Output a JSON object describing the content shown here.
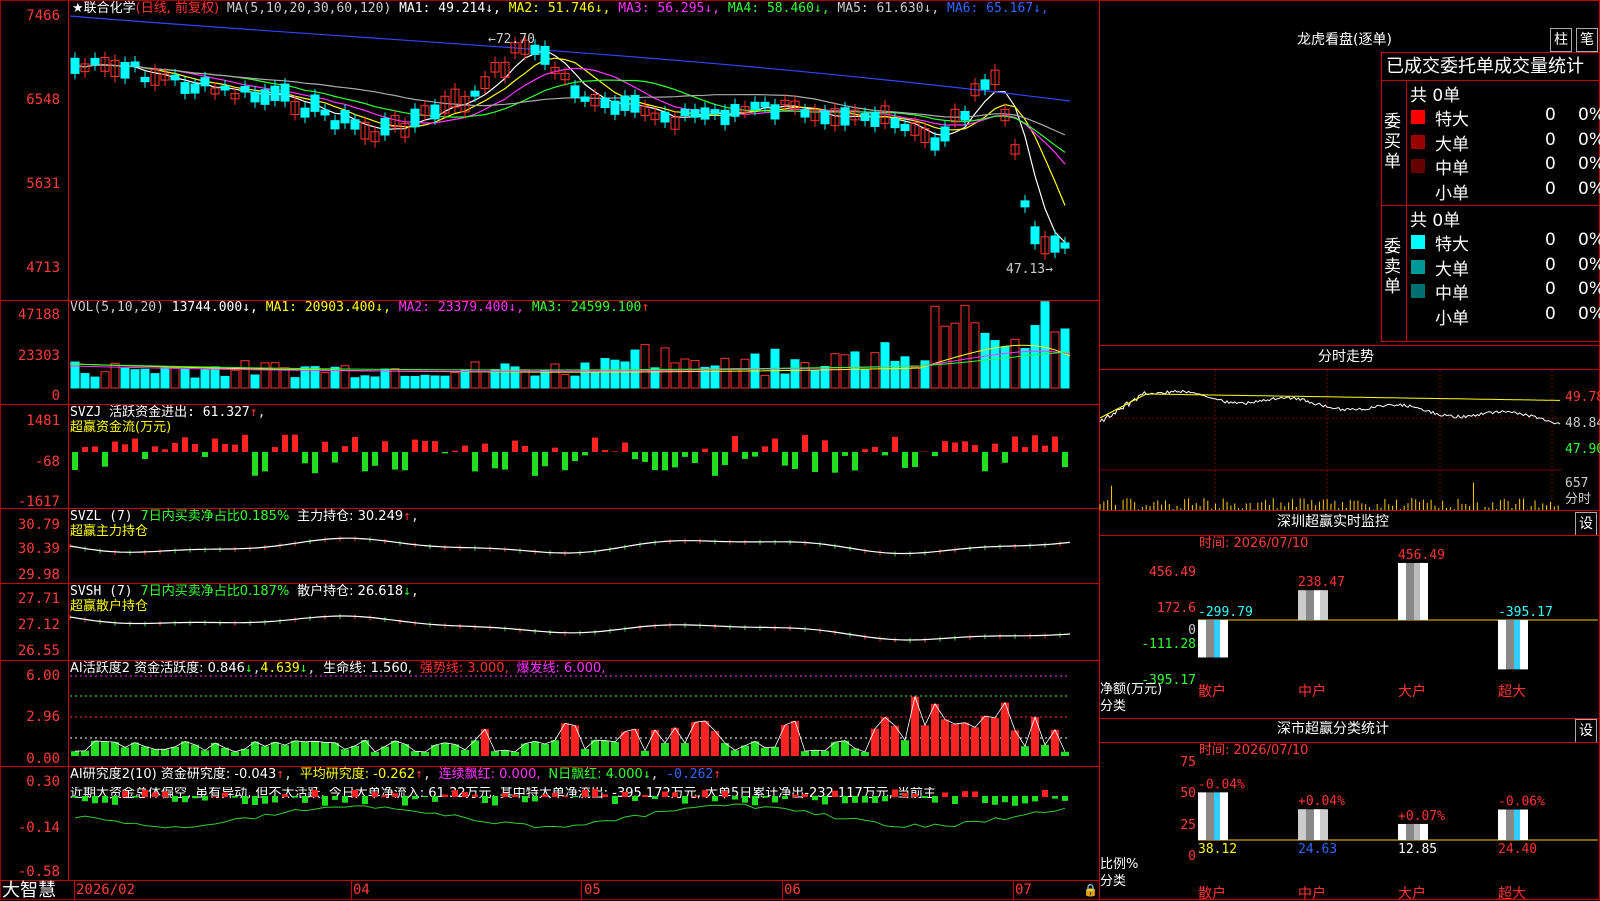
{
  "stock": {
    "title": "★联合化学",
    "mode": "(日线, 前复权)",
    "ma_label": "MA(5,10,20,30,60,120)",
    "ma": [
      {
        "k": "MA1",
        "v": "49.214",
        "arrow": "↓",
        "color": "#ffffff"
      },
      {
        "k": "MA2",
        "v": "51.746",
        "arrow": "↓",
        "color": "#ffff00"
      },
      {
        "k": "MA3",
        "v": "56.295",
        "arrow": "↓",
        "color": "#ff33ff"
      },
      {
        "k": "MA4",
        "v": "58.460",
        "arrow": "↓",
        "color": "#33ff33"
      },
      {
        "k": "MA5",
        "v": "61.630",
        "arrow": "↓",
        "color": "#cccccc"
      },
      {
        "k": "MA6",
        "v": "65.167",
        "arrow": "↓",
        "color": "#3366ff"
      }
    ],
    "high_note": "72.70",
    "low_note": "47.13",
    "price_axis": [
      "7466",
      "6548",
      "5631",
      "4713"
    ]
  },
  "volume": {
    "label": "VOL(5,10,20)",
    "value": "13744.000",
    "ma1": "MA1: 20903.400",
    "ma2": "MA2: 23379.400",
    "ma3": "MA3: 24599.100",
    "axis": [
      "47188",
      "23303",
      "0"
    ]
  },
  "svzj": {
    "label": "SVZJ  活跃资金进出: 61.327",
    "sub": "超赢资金流(万元)",
    "axis": [
      "1481",
      "-68",
      "-1617"
    ]
  },
  "svzl": {
    "label_a": "SVZL (7)",
    "label_b": "7日内买卖净占比0.185%",
    "label_c": "主力持仓: 30.249",
    "sub": "超赢主力持仓",
    "axis": [
      "30.79",
      "30.39",
      "29.98"
    ]
  },
  "svsh": {
    "label_a": "SVSH (7)",
    "label_b": "7日内买卖净占比0.187%",
    "label_c": "散户持仓: 26.618",
    "sub": "超赢散户持仓",
    "axis": [
      "27.71",
      "27.12",
      "26.55"
    ]
  },
  "ai1": {
    "label_a": "AI活跃度2 资金活跃度: 0.846",
    "label_b": "4.639",
    "label_c": "生命线: 1.560,",
    "label_d": "强势线: 3.000,",
    "label_e": "爆发线: 6.000,",
    "axis": [
      "6.00",
      "2.96",
      "0.00"
    ]
  },
  "ai2": {
    "label_a": "AI研究度2(10) 资金研究度: -0.043",
    "label_b": "平均研究度: -0.262",
    "label_c": "连续飘红: 0.000,",
    "label_d": "N日飘红: 4.000",
    "label_e": "-0.262",
    "desc": "近期大资金总体偏空, 虽有异动, 但不太活跃, 今日大单净流入: 61.32万元, 其中特大单净流出: -395.172万元, 大单5日累计净出-232.117万元, 当前主",
    "axis": [
      "0.30",
      "-0.14",
      "-0.58"
    ]
  },
  "xaxis": {
    "brand": "大智慧",
    "labels": [
      "2026/02",
      "04",
      "05",
      "06",
      "07"
    ]
  },
  "right": {
    "title": "龙虎看盘(逐单)",
    "btn1": "柱",
    "btn2": "笔",
    "header": "已成交委托单成交量统计",
    "buy_label": "委买单",
    "sell_label": "委卖单",
    "buy_total": "共 0单",
    "sell_total": "共 0单",
    "buy_rows": [
      {
        "name": "特大",
        "n": "0",
        "pct": "0%",
        "color": "#ff0000"
      },
      {
        "name": "大单",
        "n": "0",
        "pct": "0%",
        "color": "#990000"
      },
      {
        "name": "中单",
        "n": "0",
        "pct": "0%",
        "color": "#660000"
      },
      {
        "name": "小单",
        "n": "0",
        "pct": "0%",
        "color": "#000000"
      }
    ],
    "sell_rows": [
      {
        "name": "特大",
        "n": "0",
        "pct": "0%",
        "color": "#00ffff"
      },
      {
        "name": "大单",
        "n": "0",
        "pct": "0%",
        "color": "#009999"
      },
      {
        "name": "中单",
        "n": "0",
        "pct": "0%",
        "color": "#006f6f"
      },
      {
        "name": "小单",
        "n": "0",
        "pct": "0%",
        "color": "#000000"
      }
    ],
    "intraday_title": "分时走势",
    "intraday_axis": [
      "49.78",
      "48.84",
      "47.90"
    ],
    "intraday_vol": [
      "657",
      "分时"
    ],
    "monitor_title": "深圳超赢实时监控",
    "monitor_btn": "设",
    "monitor_time": "时间: 2026/07/10",
    "monitor_axis": [
      "456.49",
      "172.6",
      "0",
      "-111.28",
      "-395.17"
    ],
    "monitor_ylabel": "净额(万元)",
    "monitor_xlabel": "分类",
    "class_title": "深市超赢分类统计",
    "class_btn": "设",
    "class_time": "时间: 2026/07/10",
    "class_axis": [
      "75",
      "50",
      "25",
      "0"
    ],
    "class_ylabel": "比例%",
    "class_xlabel": "分类"
  },
  "chart_data": [
    {
      "type": "bar",
      "title": "深圳超赢实时监控",
      "ylabel": "净额(万元)",
      "xlabel": "分类",
      "categories": [
        "散户",
        "中户",
        "大户",
        "超大"
      ],
      "values": [
        -299.79,
        238.47,
        456.49,
        -395.17
      ],
      "ylim": [
        -395.17,
        456.49
      ]
    },
    {
      "type": "bar",
      "title": "深市超赢分类统计",
      "ylabel": "比例%",
      "xlabel": "分类",
      "categories": [
        "散户",
        "中户",
        "大户",
        "超大"
      ],
      "values": [
        38.12,
        24.63,
        12.85,
        24.4
      ],
      "changes": [
        "-0.04%",
        "+0.04%",
        "+0.07%",
        "-0.06%"
      ],
      "ylim": [
        0,
        75
      ]
    }
  ]
}
